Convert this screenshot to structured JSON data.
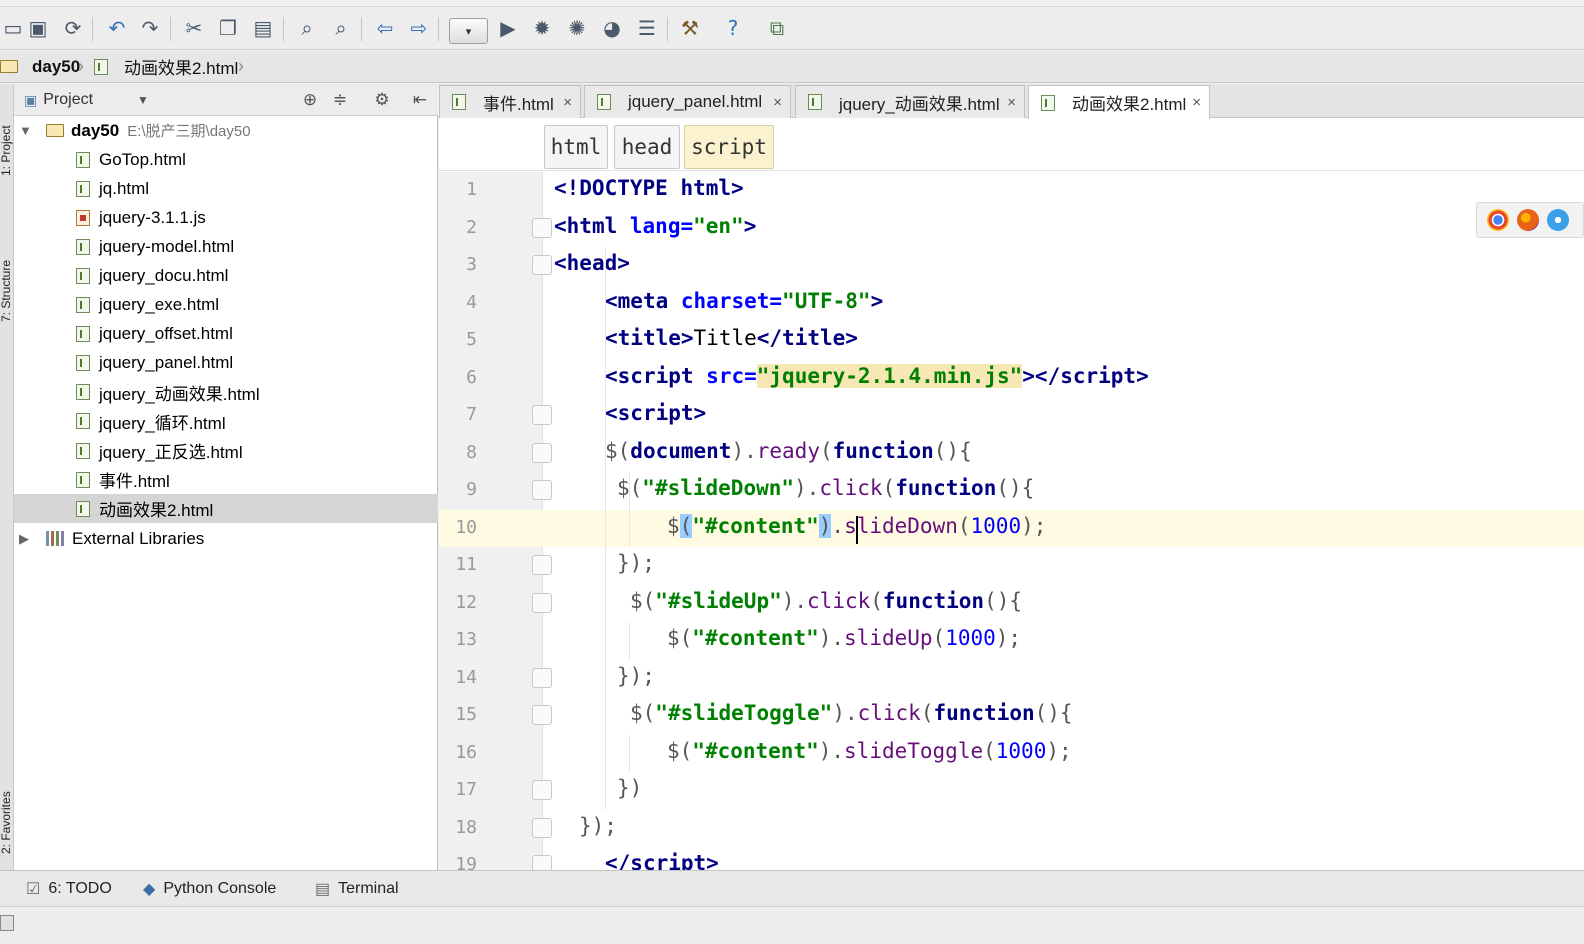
{
  "navbar": {
    "project": "day50",
    "file": "动画效果2.html"
  },
  "side_stripe": {
    "project": "1: Project",
    "structure": "7: Structure",
    "favorites": "2: Favorites"
  },
  "project_panel": {
    "view_selector": "Project",
    "root": {
      "name": "day50",
      "path": "E:\\脱产三期\\day50"
    },
    "files": [
      {
        "name": "GoTop.html",
        "type": "html"
      },
      {
        "name": "jq.html",
        "type": "html"
      },
      {
        "name": "jquery-3.1.1.js",
        "type": "js"
      },
      {
        "name": "jquery-model.html",
        "type": "html"
      },
      {
        "name": "jquery_docu.html",
        "type": "html"
      },
      {
        "name": "jquery_exe.html",
        "type": "html"
      },
      {
        "name": "jquery_offset.html",
        "type": "html"
      },
      {
        "name": "jquery_panel.html",
        "type": "html"
      },
      {
        "name": "jquery_动画效果.html",
        "type": "html"
      },
      {
        "name": "jquery_循环.html",
        "type": "html"
      },
      {
        "name": "jquery_正反选.html",
        "type": "html"
      },
      {
        "name": "事件.html",
        "type": "html"
      },
      {
        "name": "动画效果2.html",
        "type": "html",
        "selected": true
      }
    ],
    "external": "External Libraries"
  },
  "tabs": [
    {
      "label": "事件.html",
      "active": false
    },
    {
      "label": "jquery_panel.html",
      "active": false
    },
    {
      "label": "jquery_动画效果.html",
      "active": false
    },
    {
      "label": "动画效果2.html",
      "active": true
    }
  ],
  "breadcrumbs": [
    "html",
    "head",
    "script"
  ],
  "editor": {
    "current_line": 10,
    "line_numbers": [
      "1",
      "2",
      "3",
      "4",
      "5",
      "6",
      "7",
      "8",
      "9",
      "10",
      "11",
      "12",
      "13",
      "14",
      "15",
      "16",
      "17",
      "18",
      "19"
    ],
    "lines": [
      [
        "<!DOCTYPE ",
        "html",
        ">"
      ],
      [
        "<",
        "html",
        " ",
        "lang=",
        "\"en\"",
        ">"
      ],
      [
        "<",
        "head",
        ">"
      ],
      [
        "<",
        "meta",
        " ",
        "charset=",
        "\"UTF-8\"",
        ">"
      ],
      [
        "<",
        "title",
        ">",
        "Title",
        "</",
        "title",
        ">"
      ],
      [
        "<",
        "script",
        " ",
        "src=",
        "\"",
        "jquery-2.1.4.min.js",
        "\"",
        "></",
        "script",
        ">"
      ],
      [
        "<",
        "script",
        ">"
      ],
      [
        "$(",
        "document",
        ").",
        "ready",
        "(",
        "function",
        "(){"
      ],
      [
        "$(",
        "\"#slideDown\"",
        ").",
        "click",
        "(",
        "function",
        "(){"
      ],
      [
        "$",
        "(",
        "\"#content\"",
        ")",
        ".",
        "slideDown",
        "(",
        "1000",
        ");"
      ],
      [
        "});"
      ],
      [
        "$(",
        "\"#slideUp\"",
        ").",
        "click",
        "(",
        "function",
        "(){"
      ],
      [
        "$(",
        "\"#content\"",
        ").",
        "slideUp",
        "(",
        "1000",
        ");"
      ],
      [
        "});"
      ],
      [
        "$(",
        "\"#slideToggle\"",
        ").",
        "click",
        "(",
        "function",
        "(){"
      ],
      [
        "$(",
        "\"#content\"",
        ").",
        "slideToggle",
        "(",
        "1000",
        ");"
      ],
      [
        "})"
      ],
      [
        "});"
      ],
      [
        "</",
        "script",
        ">"
      ]
    ]
  },
  "tool_windows": [
    {
      "label": "6: TODO",
      "icon": "todo-icon"
    },
    {
      "label": "Python Console",
      "icon": "python-icon"
    },
    {
      "label": "Terminal",
      "icon": "terminal-icon"
    }
  ],
  "icons": {
    "toolbar": [
      "folder-icon",
      "save-icon",
      "sync-icon",
      "undo-icon",
      "redo-icon",
      "cut-icon",
      "copy-icon",
      "paste-icon",
      "find-icon",
      "replace-icon",
      "back-icon",
      "forward-icon",
      "run-config-dropdown",
      "run-icon",
      "debug-icon",
      "coverage-icon",
      "profile-icon",
      "build-icon",
      "settings-icon",
      "help-icon",
      "vcs-icon"
    ],
    "browsers": [
      "chrome-icon",
      "firefox-icon",
      "safari-icon"
    ]
  },
  "colors": {
    "tag": "#000080",
    "string": "#008000",
    "function": "#660e7a",
    "current_line": "#fffbe3",
    "selection": "#d5d5d5"
  }
}
